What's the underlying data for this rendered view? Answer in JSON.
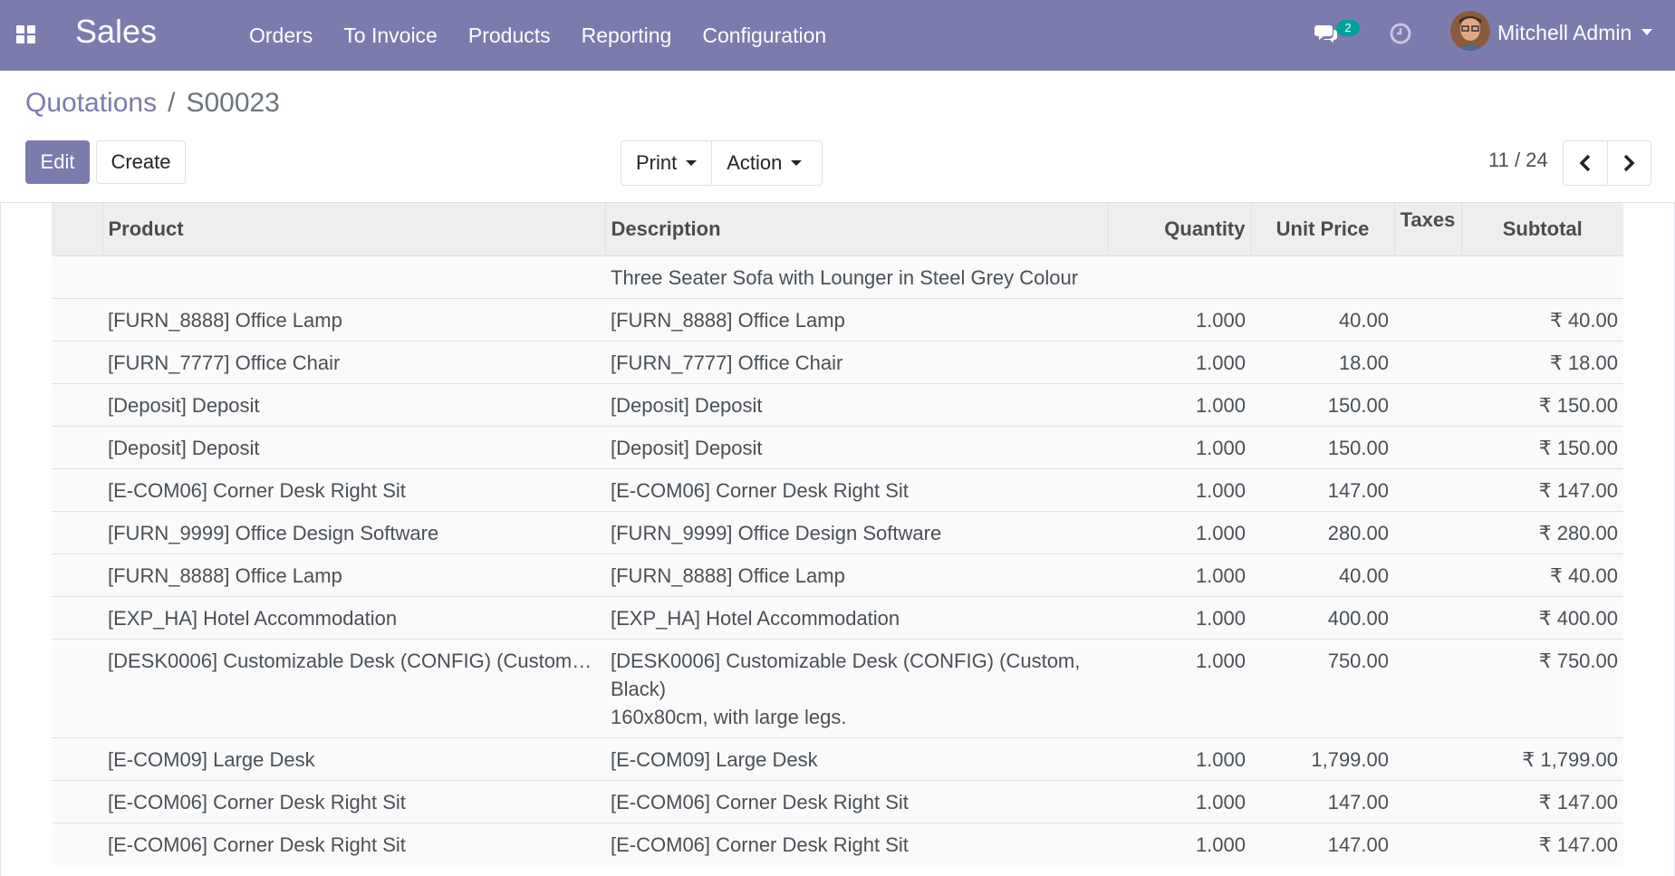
{
  "navbar": {
    "app_name": "Sales",
    "menu": [
      "Orders",
      "To Invoice",
      "Products",
      "Reporting",
      "Configuration"
    ],
    "chat_count": "2",
    "user_name": "Mitchell Admin",
    "color": "#7c7bad"
  },
  "breadcrumb": {
    "parent": "Quotations",
    "separator": "/",
    "current": "S00023"
  },
  "toolbar": {
    "edit_label": "Edit",
    "create_label": "Create",
    "print_label": "Print",
    "action_label": "Action"
  },
  "pager": {
    "value": "11 / 24"
  },
  "table": {
    "headers": {
      "product": "Product",
      "description": "Description",
      "quantity": "Quantity",
      "unit_price": "Unit Price",
      "taxes": "Taxes",
      "subtotal": "Subtotal"
    },
    "partial_top_description": "Three Seater Sofa with Lounger in Steel Grey Colour",
    "rows": [
      {
        "product": "[FURN_8888] Office Lamp",
        "description": "[FURN_8888] Office Lamp",
        "quantity": "1.000",
        "unit_price": "40.00",
        "taxes": "",
        "subtotal": "₹ 40.00"
      },
      {
        "product": "[FURN_7777] Office Chair",
        "description": "[FURN_7777] Office Chair",
        "quantity": "1.000",
        "unit_price": "18.00",
        "taxes": "",
        "subtotal": "₹ 18.00"
      },
      {
        "product": "[Deposit] Deposit",
        "description": "[Deposit] Deposit",
        "quantity": "1.000",
        "unit_price": "150.00",
        "taxes": "",
        "subtotal": "₹ 150.00"
      },
      {
        "product": "[Deposit] Deposit",
        "description": "[Deposit] Deposit",
        "quantity": "1.000",
        "unit_price": "150.00",
        "taxes": "",
        "subtotal": "₹ 150.00"
      },
      {
        "product": "[E-COM06] Corner Desk Right Sit",
        "description": "[E-COM06] Corner Desk Right Sit",
        "quantity": "1.000",
        "unit_price": "147.00",
        "taxes": "",
        "subtotal": "₹ 147.00"
      },
      {
        "product": "[FURN_9999] Office Design Software",
        "description": "[FURN_9999] Office Design Software",
        "quantity": "1.000",
        "unit_price": "280.00",
        "taxes": "",
        "subtotal": "₹ 280.00"
      },
      {
        "product": "[FURN_8888] Office Lamp",
        "description": "[FURN_8888] Office Lamp",
        "quantity": "1.000",
        "unit_price": "40.00",
        "taxes": "",
        "subtotal": "₹ 40.00"
      },
      {
        "product": "[EXP_HA] Hotel Accommodation",
        "description": "[EXP_HA] Hotel Accommodation",
        "quantity": "1.000",
        "unit_price": "400.00",
        "taxes": "",
        "subtotal": "₹ 400.00"
      },
      {
        "product": "[DESK0006] Customizable Desk (CONFIG) (Custom…",
        "description": "[DESK0006] Customizable Desk (CONFIG) (Custom, Black)",
        "description_extra": "160x80cm, with large legs.",
        "quantity": "1.000",
        "unit_price": "750.00",
        "taxes": "",
        "subtotal": "₹ 750.00"
      },
      {
        "product": "[E-COM09] Large Desk",
        "description": "[E-COM09] Large Desk",
        "quantity": "1.000",
        "unit_price": "1,799.00",
        "taxes": "",
        "subtotal": "₹ 1,799.00"
      },
      {
        "product": "[E-COM06] Corner Desk Right Sit",
        "description": "[E-COM06] Corner Desk Right Sit",
        "quantity": "1.000",
        "unit_price": "147.00",
        "taxes": "",
        "subtotal": "₹ 147.00"
      },
      {
        "product": "[E-COM06] Corner Desk Right Sit",
        "description": "[E-COM06] Corner Desk Right Sit",
        "quantity": "1.000",
        "unit_price": "147.00",
        "taxes": "",
        "subtotal": "₹ 147.00"
      }
    ]
  }
}
